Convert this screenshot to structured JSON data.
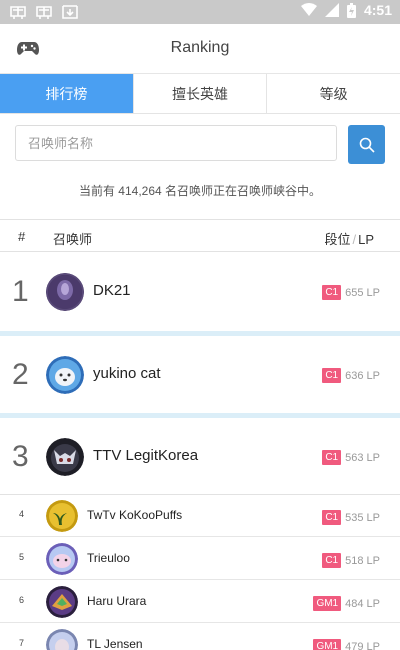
{
  "status_bar": {
    "time": "4:51"
  },
  "header": {
    "title": "Ranking"
  },
  "tabs": [
    {
      "label": "排行榜",
      "active": true
    },
    {
      "label": "擅长英雄",
      "active": false
    },
    {
      "label": "等级",
      "active": false
    }
  ],
  "search": {
    "placeholder": "召唤师名称",
    "value": ""
  },
  "summary": {
    "text": "当前有 414,264 名召唤师正在召唤师峡谷中。"
  },
  "table": {
    "col_rank": "#",
    "col_name": "召唤师",
    "col_tier": "段位",
    "col_tier_sep": "/",
    "col_lp": "LP",
    "rows": [
      {
        "rank": "1",
        "name": "DK21",
        "tier": "C1",
        "lp": "655 LP"
      },
      {
        "rank": "2",
        "name": "yukino cat",
        "tier": "C1",
        "lp": "636 LP"
      },
      {
        "rank": "3",
        "name": "TTV LegitKorea",
        "tier": "C1",
        "lp": "563 LP"
      },
      {
        "rank": "4",
        "name": "TwTv KoKooPuffs",
        "tier": "C1",
        "lp": "535 LP"
      },
      {
        "rank": "5",
        "name": "Trieuloo",
        "tier": "C1",
        "lp": "518 LP"
      },
      {
        "rank": "6",
        "name": "Haru Urara",
        "tier": "GM1",
        "lp": "484 LP"
      },
      {
        "rank": "7",
        "name": "TL Jensen",
        "tier": "GM1",
        "lp": "479 LP"
      }
    ]
  },
  "colors": {
    "tab_active": "#4a9ff2",
    "search_button": "#3c8fd6",
    "tier_badge": "#f05a7e",
    "band": "#dbeef8",
    "status_bar": "#c9c9c9"
  }
}
